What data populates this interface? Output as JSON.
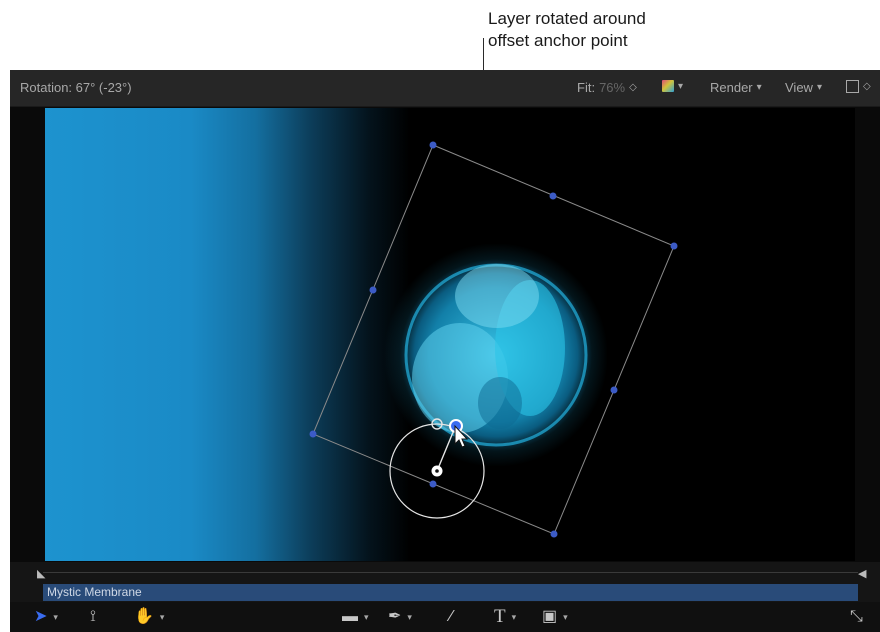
{
  "annotation": {
    "line1": "Layer rotated around",
    "line2": "offset anchor point"
  },
  "viewer": {
    "rotation_readout": "Rotation: 67° (-23°)",
    "fit_label": "Fit:",
    "fit_value": "76%",
    "render_label": "Render",
    "view_label": "View"
  },
  "timeline": {
    "clip_name": "Mystic Membrane"
  },
  "toolbar": {
    "text_tool_glyph": "T"
  },
  "colors": {
    "accent_blue": "#3a6cf0",
    "clip_bar": "#294b79",
    "canvas_gradient_start": "#1d93cf"
  }
}
